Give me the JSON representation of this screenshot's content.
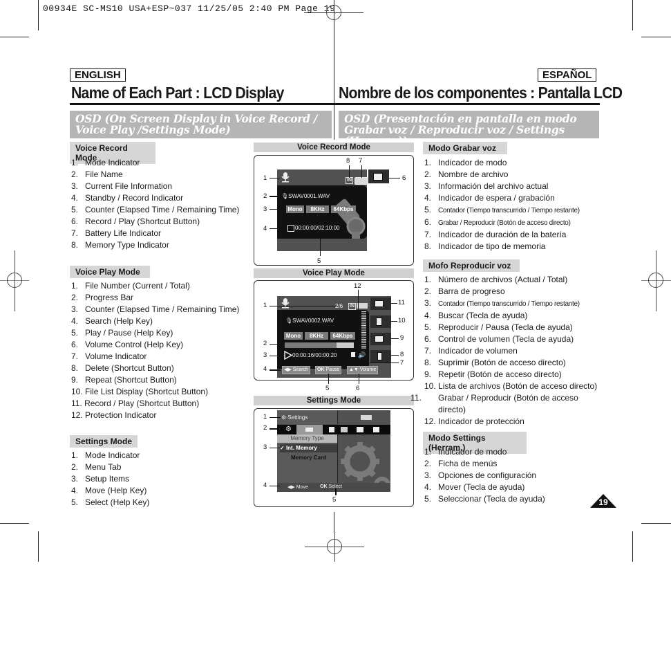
{
  "print_header": {
    "text": "00934E SC-MS10 USA+ESP~037   11/25/05 2:40 PM  Page 19"
  },
  "english": {
    "lang_label": "ENGLISH",
    "title": "Name of Each Part : LCD Display",
    "osd_heading": "OSD (On Screen Display in Voice Record / Voice Play /Settings Mode)",
    "voice_record": {
      "heading": "Voice Record Mode",
      "items": [
        {
          "num": "1.",
          "text": "Mode Indicator"
        },
        {
          "num": "2.",
          "text": "File Name"
        },
        {
          "num": "3.",
          "text": "Current File Information"
        },
        {
          "num": "4.",
          "text": "Standby / Record Indicator"
        },
        {
          "num": "5.",
          "text": "Counter (Elapsed Time / Remaining Time)"
        },
        {
          "num": "6.",
          "text": "Record / Play (Shortcut Button)"
        },
        {
          "num": "7.",
          "text": "Battery Life Indicator"
        },
        {
          "num": "8.",
          "text": "Memory Type Indicator"
        }
      ]
    },
    "voice_play": {
      "heading": "Voice Play Mode",
      "items": [
        {
          "num": "1.",
          "text": "File Number (Current / Total)"
        },
        {
          "num": "2.",
          "text": "Progress Bar"
        },
        {
          "num": "3.",
          "text": "Counter (Elapsed Time / Remaining Time)"
        },
        {
          "num": "4.",
          "text": "Search (Help Key)"
        },
        {
          "num": "5.",
          "text": "Play / Pause (Help Key)"
        },
        {
          "num": "6.",
          "text": "Volume Control (Help Key)"
        },
        {
          "num": "7.",
          "text": "Volume Indicator"
        },
        {
          "num": "8.",
          "text": "Delete (Shortcut Button)"
        },
        {
          "num": "9.",
          "text": "Repeat (Shortcut Button)"
        },
        {
          "num": "10.",
          "text": "File List Display (Shortcut Button)"
        },
        {
          "num": "11.",
          "text": "Record / Play (Shortcut Button)"
        },
        {
          "num": "12.",
          "text": "Protection Indicator"
        }
      ]
    },
    "settings": {
      "heading": "Settings Mode",
      "items": [
        {
          "num": "1.",
          "text": "Mode Indicator"
        },
        {
          "num": "2.",
          "text": "Menu Tab"
        },
        {
          "num": "3.",
          "text": "Setup Items"
        },
        {
          "num": "4.",
          "text": "Move (Help Key)"
        },
        {
          "num": "5.",
          "text": "Select (Help Key)"
        }
      ]
    }
  },
  "spanish": {
    "lang_label": "ESPAÑOL",
    "title": "Nombre de los componentes : Pantalla LCD",
    "osd_heading": "OSD (Presentación en pantalla en modo Grabar voz / Reproducir voz / Settings (Herram.))",
    "voice_record": {
      "heading": "Modo Grabar voz",
      "items": [
        {
          "num": "1.",
          "text": "Indicador de modo"
        },
        {
          "num": "2.",
          "text": "Nombre de archivo"
        },
        {
          "num": "3.",
          "text": "Información del archivo actual"
        },
        {
          "num": "4.",
          "text": "Indicador de espera / grabación"
        },
        {
          "num": "5.",
          "text": "Contador (Tiempo transcurrido / Tiempo restante)"
        },
        {
          "num": "6.",
          "text": "Grabar / Reproducir (Botón de acceso directo)"
        },
        {
          "num": "7.",
          "text": "Indicador de duración de la batería"
        },
        {
          "num": "8.",
          "text": "Indicador de tipo de memoria"
        }
      ]
    },
    "voice_play": {
      "heading": "Mofo Reproducir voz",
      "items": [
        {
          "num": "1.",
          "text": "Número de archivos (Actual / Total)"
        },
        {
          "num": "2.",
          "text": "Barra de progreso"
        },
        {
          "num": "3.",
          "text": "Contador (Tiempo transcurrido / Tiempo restante)"
        },
        {
          "num": "4.",
          "text": "Buscar (Tecla de ayuda)"
        },
        {
          "num": "5.",
          "text": "Reproducir / Pausa (Tecla de ayuda)"
        },
        {
          "num": "6.",
          "text": "Control de volumen (Tecla de ayuda)"
        },
        {
          "num": "7.",
          "text": "Indicador de volumen"
        },
        {
          "num": "8.",
          "text": "Suprimir (Botón de acceso directo)"
        },
        {
          "num": "9.",
          "text": "Repetir (Botón de acceso directo)"
        },
        {
          "num": "10.",
          "text": "Lista de archivos (Botón de acceso directo)"
        },
        {
          "num": "11.",
          "text": "Grabar / Reproducir (Botón de acceso directo)"
        },
        {
          "num": "12.",
          "text": "Indicador de protección"
        }
      ]
    },
    "settings": {
      "heading": "Modo Settings (Herram.)",
      "items": [
        {
          "num": "1.",
          "text": "Indicador de modo"
        },
        {
          "num": "2.",
          "text": "Ficha de menús"
        },
        {
          "num": "3.",
          "text": "Opciones de configuración"
        },
        {
          "num": "4.",
          "text": "Mover (Tecla de ayuda)"
        },
        {
          "num": "5.",
          "text": "Seleccionar (Tecla de ayuda)"
        }
      ]
    }
  },
  "diagrams": {
    "record": {
      "heading": "Voice Record Mode",
      "filename": "SWAV0001.WAV",
      "info": [
        "Mono",
        "8KHz",
        "64Kbps"
      ],
      "counter": "00:00:00/02:10:00",
      "memory_label": "IN",
      "callouts": [
        "1",
        "2",
        "3",
        "4",
        "5",
        "6",
        "7",
        "8"
      ]
    },
    "play": {
      "heading": "Voice Play Mode",
      "file_number": "2/6",
      "memory_label": "IN",
      "filename": "SWAV0002.WAV",
      "info": [
        "Mono",
        "8KHz",
        "64Kbps"
      ],
      "progress": 0.75,
      "counter": "00:00:16/00:00:20",
      "help_keys": [
        "Search",
        "Pause",
        "Volume"
      ],
      "ok_label": "OK",
      "callouts": [
        "1",
        "2",
        "3",
        "4",
        "5",
        "6",
        "7",
        "8",
        "9",
        "10",
        "11",
        "12"
      ]
    },
    "settings": {
      "heading": "Settings Mode",
      "mode_label": "Settings",
      "menu_title": "Memory Type",
      "options": [
        "Int. Memory",
        "Memory Card"
      ],
      "selected_option": "Int. Memory",
      "check_mark": "✓",
      "help_keys": [
        "Move",
        "Select"
      ],
      "ok_label": "OK",
      "callouts": [
        "1",
        "2",
        "3",
        "4",
        "5"
      ]
    }
  },
  "page_number": "19"
}
